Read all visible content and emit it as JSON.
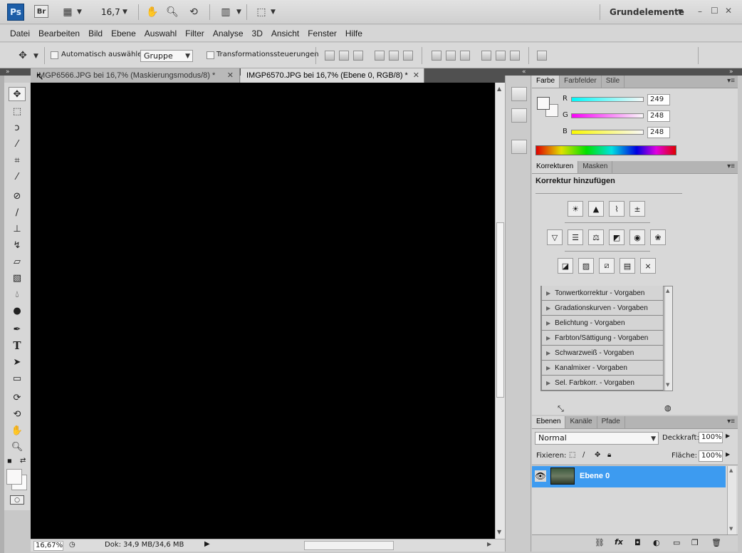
{
  "app": {
    "logo": "Ps",
    "bridge": "Br",
    "zoom_select": "16,7",
    "workspace": "Grundelemente",
    "window_controls": [
      "–",
      "☐",
      "✕"
    ]
  },
  "menu": [
    "Datei",
    "Bearbeiten",
    "Bild",
    "Ebene",
    "Auswahl",
    "Filter",
    "Analyse",
    "3D",
    "Ansicht",
    "Fenster",
    "Hilfe"
  ],
  "options": {
    "auto_select_label": "Automatisch auswählen:",
    "auto_select_value": "Gruppe",
    "transform_label": "Transformationssteuerungen"
  },
  "tabs": [
    {
      "label": "IMGP6566.JPG bei 16,7% (Maskierungsmodus/8) *",
      "close": "✕"
    },
    {
      "label": "IMGP6570.JPG bei 16,7% (Ebene 0, RGB/8) *",
      "close": "✕"
    }
  ],
  "status": {
    "zoom": "16,67%",
    "doc": "Dok: 34,9 MB/34,6 MB"
  },
  "color_panel": {
    "tabs": [
      "Farbe",
      "Farbfelder",
      "Stile"
    ],
    "channels": [
      {
        "label": "R",
        "value": "249"
      },
      {
        "label": "G",
        "value": "248"
      },
      {
        "label": "B",
        "value": "248"
      }
    ]
  },
  "adjustments_panel": {
    "tabs": [
      "Korrekturen",
      "Masken"
    ],
    "title": "Korrektur hinzufügen",
    "presets": [
      "Tonwertkorrektur - Vorgaben",
      "Gradationskurven - Vorgaben",
      "Belichtung - Vorgaben",
      "Farbton/Sättigung - Vorgaben",
      "Schwarzweiß - Vorgaben",
      "Kanalmixer - Vorgaben",
      "Sel. Farbkorr. - Vorgaben"
    ]
  },
  "layers_panel": {
    "tabs": [
      "Ebenen",
      "Kanäle",
      "Pfade"
    ],
    "blend_mode": "Normal",
    "opacity_label": "Deckkraft:",
    "opacity_value": "100%",
    "lock_label": "Fixieren:",
    "fill_label": "Fläche:",
    "fill_value": "100%",
    "layer_name": "Ebene 0"
  },
  "colors": {
    "selection_blue": "#3d9bf0",
    "canvas": "#000000",
    "ps_blue": "#1d5ea8"
  }
}
